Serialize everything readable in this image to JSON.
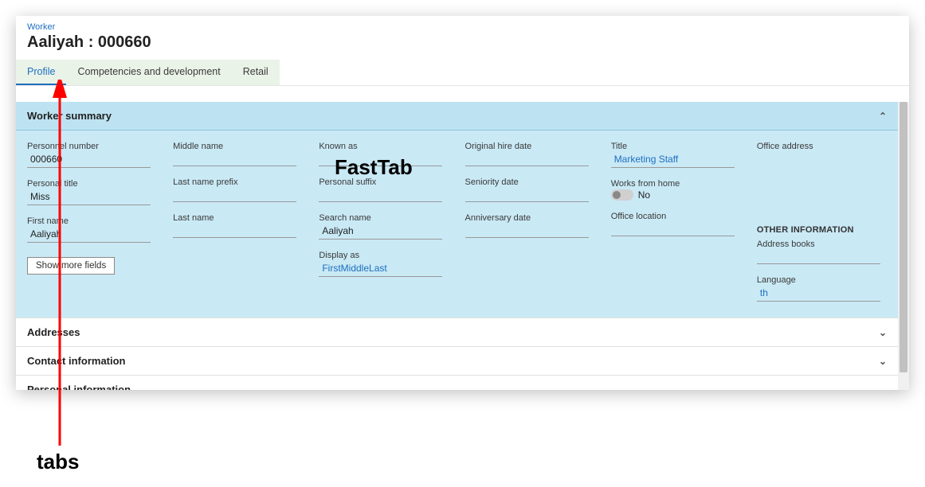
{
  "breadcrumb": "Worker",
  "page_title": "Aaliyah : 000660",
  "tabs": [
    {
      "label": "Profile"
    },
    {
      "label": "Competencies and development"
    },
    {
      "label": "Retail"
    }
  ],
  "worker_summary": {
    "header": "Worker summary",
    "personnel_number": {
      "label": "Personnel number",
      "value": "000660"
    },
    "personal_title": {
      "label": "Personal title",
      "value": "Miss"
    },
    "first_name": {
      "label": "First name",
      "value": "Aaliyah"
    },
    "middle_name": {
      "label": "Middle name",
      "value": ""
    },
    "last_name_prefix": {
      "label": "Last name prefix",
      "value": ""
    },
    "last_name": {
      "label": "Last name",
      "value": ""
    },
    "known_as": {
      "label": "Known as",
      "value": ""
    },
    "personal_suffix": {
      "label": "Personal suffix",
      "value": ""
    },
    "search_name": {
      "label": "Search name",
      "value": "Aaliyah"
    },
    "display_as": {
      "label": "Display as",
      "value": "FirstMiddleLast"
    },
    "original_hire_date": {
      "label": "Original hire date",
      "value": ""
    },
    "seniority_date": {
      "label": "Seniority date",
      "value": ""
    },
    "anniversary_date": {
      "label": "Anniversary date",
      "value": ""
    },
    "title": {
      "label": "Title",
      "value": "Marketing Staff"
    },
    "works_from_home": {
      "label": "Works from home",
      "value": "No"
    },
    "office_location": {
      "label": "Office location",
      "value": ""
    },
    "office_address": {
      "label": "Office address",
      "value": ""
    },
    "other_info_header": "OTHER INFORMATION",
    "address_books": {
      "label": "Address books",
      "value": ""
    },
    "language": {
      "label": "Language",
      "value": "th"
    },
    "show_more": "Show more fields"
  },
  "collapsed_tabs": [
    {
      "label": "Addresses"
    },
    {
      "label": "Contact information"
    },
    {
      "label": "Personal information"
    }
  ],
  "annotations": {
    "fasttab": "FastTab",
    "tabs": "tabs"
  }
}
